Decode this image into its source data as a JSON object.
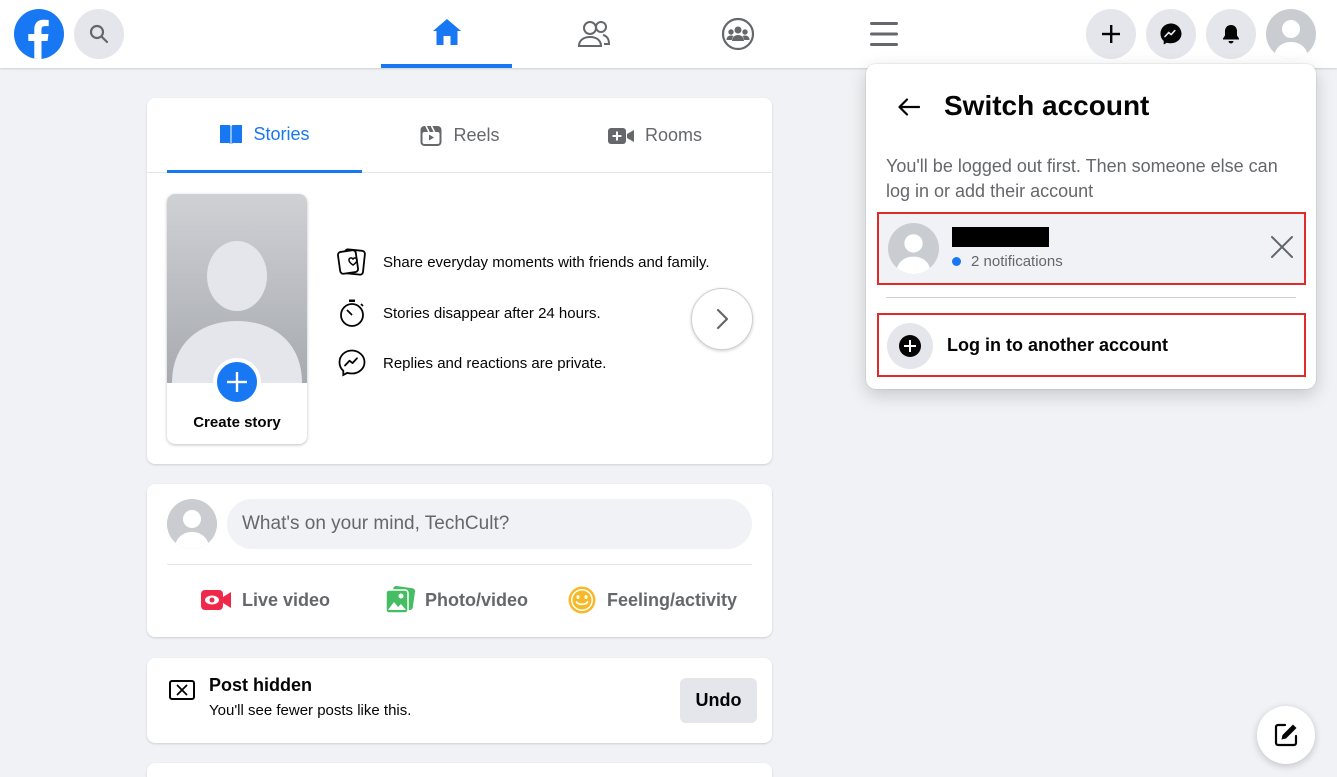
{
  "colors": {
    "brand": "#1877f2",
    "highlight_border": "#e02b2b",
    "page_bg": "#f0f2f5"
  },
  "topbar": {
    "logo_icon": "facebook-logo",
    "search_icon": "search-icon",
    "nav": [
      {
        "icon": "home-icon",
        "active": true
      },
      {
        "icon": "friends-icon",
        "active": false
      },
      {
        "icon": "groups-icon",
        "active": false
      },
      {
        "icon": "menu-icon",
        "active": false
      }
    ],
    "actions": [
      "plus-icon",
      "messenger-icon",
      "bell-icon",
      "avatar"
    ]
  },
  "stories_card": {
    "tabs": [
      {
        "label": "Stories",
        "icon": "book-icon",
        "active": true
      },
      {
        "label": "Reels",
        "icon": "reels-icon",
        "active": false
      },
      {
        "label": "Rooms",
        "icon": "video-plus-icon",
        "active": false
      }
    ],
    "create_story": "Create story",
    "info": [
      {
        "icon": "photo-heart-icon",
        "text": "Share everyday moments with friends and family."
      },
      {
        "icon": "stopwatch-icon",
        "text": "Stories disappear after 24 hours."
      },
      {
        "icon": "messenger-icon",
        "text": "Replies and reactions are private."
      }
    ]
  },
  "composer": {
    "placeholder": "What's on your mind, TechCult?",
    "actions": [
      {
        "label": "Live video",
        "icon": "live-video-icon"
      },
      {
        "label": "Photo/video",
        "icon": "photo-icon"
      },
      {
        "label": "Feeling/activity",
        "icon": "smiley-icon"
      }
    ]
  },
  "hidden_post": {
    "title": "Post hidden",
    "subtitle": "You'll see fewer posts like this.",
    "undo": "Undo"
  },
  "switch_account": {
    "title": "Switch account",
    "description": "You'll be logged out first. Then someone else can log in or add their account",
    "account": {
      "notifications": "2 notifications"
    },
    "login_label": "Log in to another account"
  }
}
